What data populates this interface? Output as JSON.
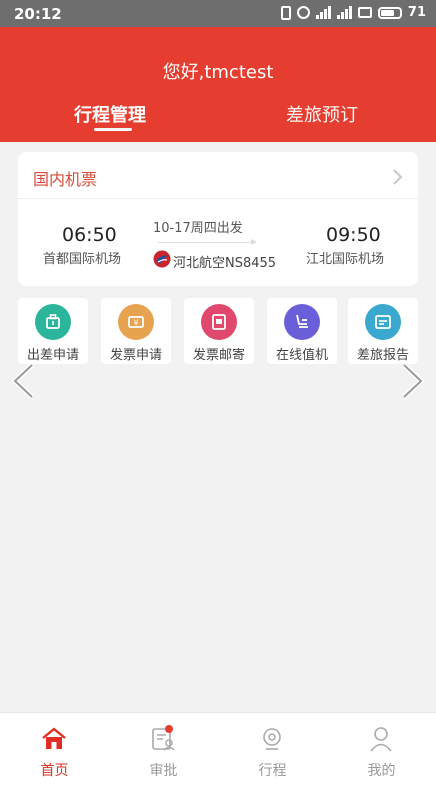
{
  "status": {
    "time": "20:12",
    "battery": "71"
  },
  "header": {
    "greeting": "您好,tmctest",
    "tabs": [
      {
        "label": "行程管理",
        "active": true
      },
      {
        "label": "差旅预订",
        "active": false
      }
    ]
  },
  "flight_card": {
    "title": "国内机票",
    "departure_time": "06:50",
    "departure_airport": "首都国际机场",
    "date": "10-17周四出发",
    "airline": "河北航空NS8455",
    "arrival_time": "09:50",
    "arrival_airport": "江北国际机场"
  },
  "menu": [
    {
      "label": "出差申请",
      "icon": "briefcase-icon",
      "color": "#2bb59a"
    },
    {
      "label": "发票申请",
      "icon": "invoice-icon",
      "color": "#e8a350"
    },
    {
      "label": "发票邮寄",
      "icon": "mail-icon",
      "color": "#e0486e"
    },
    {
      "label": "在线值机",
      "icon": "seat-icon",
      "color": "#6a5fd8"
    },
    {
      "label": "差旅报告",
      "icon": "report-icon",
      "color": "#3aa8cf"
    }
  ],
  "tabbar": [
    {
      "label": "首页",
      "icon": "home-icon",
      "active": true
    },
    {
      "label": "审批",
      "icon": "approval-icon",
      "active": false
    },
    {
      "label": "行程",
      "icon": "trip-icon",
      "active": false
    },
    {
      "label": "我的",
      "icon": "user-icon",
      "active": false
    }
  ],
  "colors": {
    "brand": "#e63d31",
    "active_tab": "#e02e24"
  }
}
